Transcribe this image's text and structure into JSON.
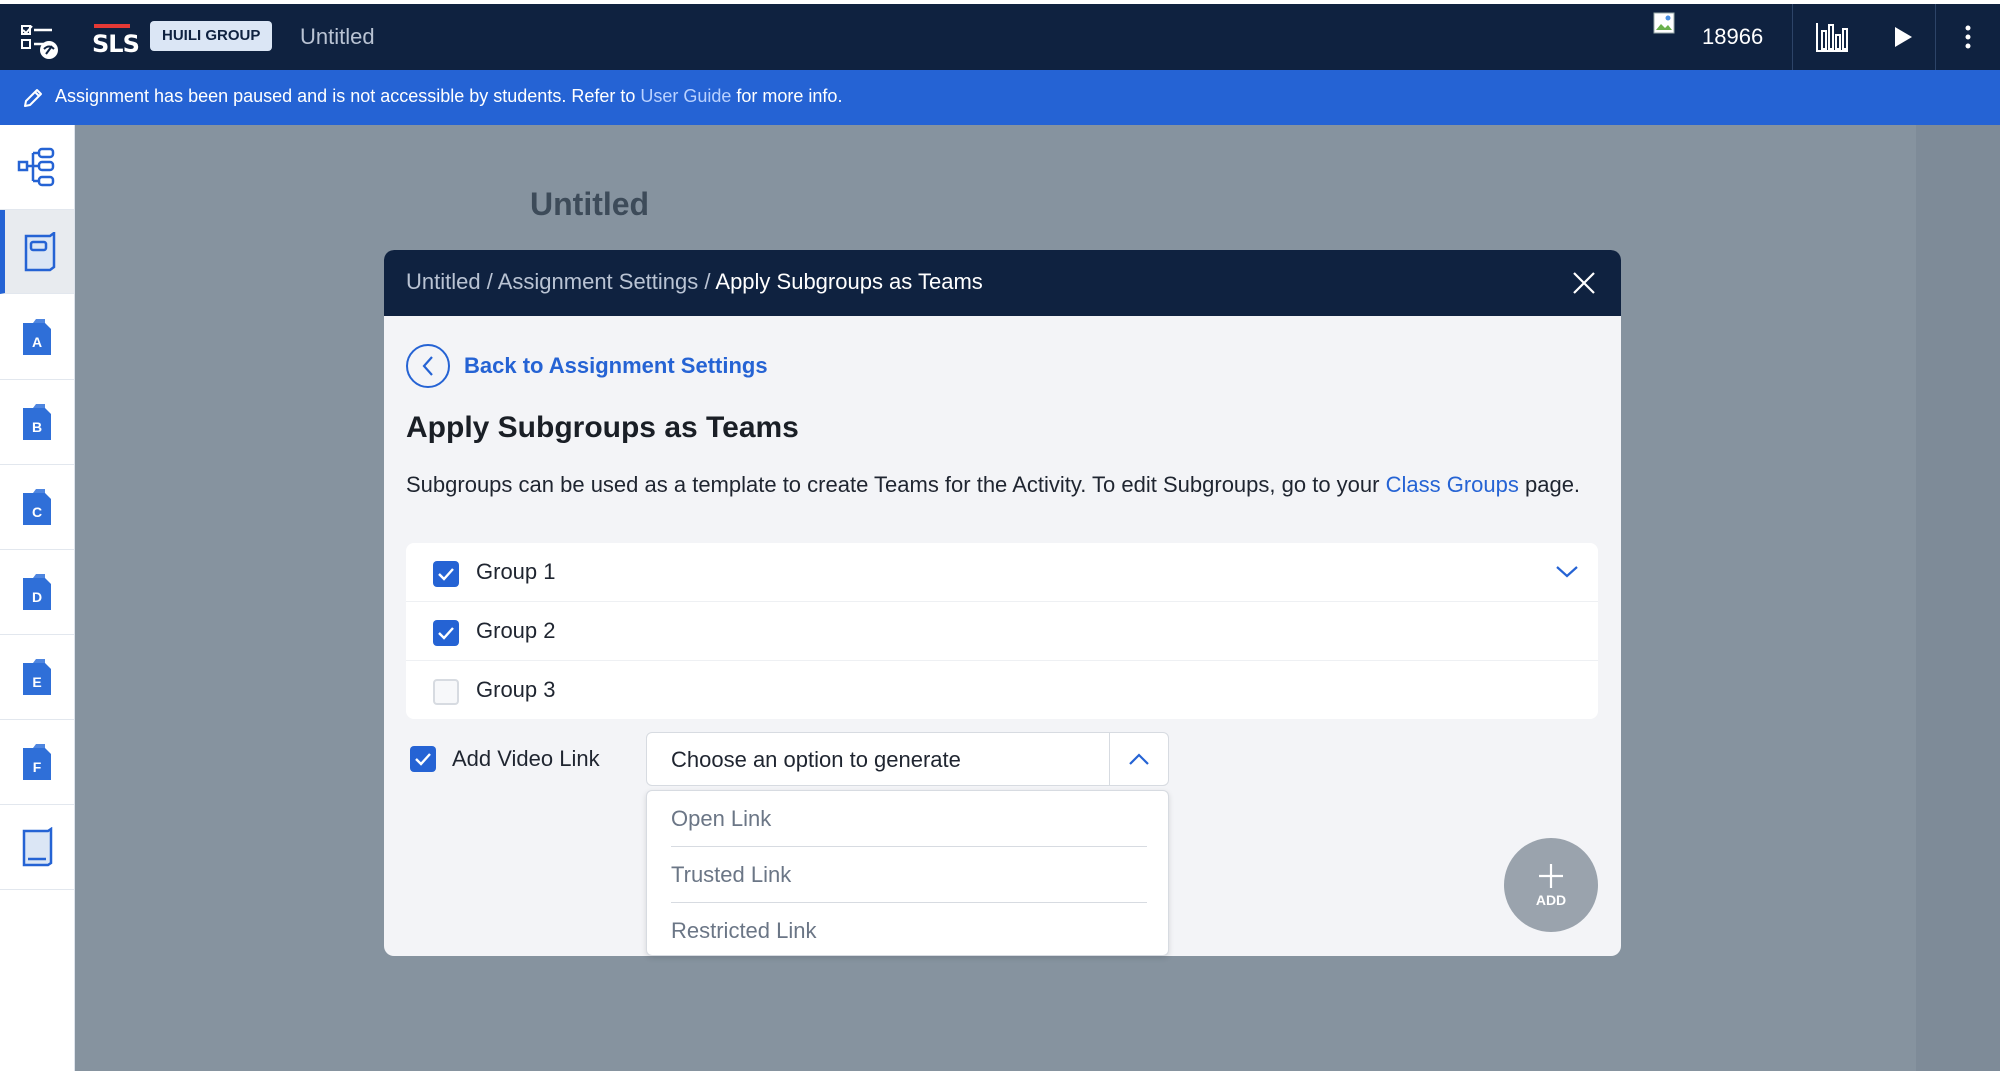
{
  "topbar": {
    "app_icon": "checklist-globe-icon",
    "logo_text": "SLS",
    "group_badge": "HUILI GROUP",
    "title": "Untitled",
    "points": "18966",
    "analytics_icon": "bar-chart-icon",
    "play_icon": "play-icon",
    "more_icon": "more-vertical-icon"
  },
  "banner": {
    "icon": "pencil-icon",
    "text_before": "Assignment has been paused and is not accessible by students. Refer to ",
    "link": "User Guide",
    "text_after": " for more info."
  },
  "sidebar": {
    "items": [
      {
        "icon": "tree-structure-icon"
      },
      {
        "icon": "cover-page-icon"
      },
      {
        "icon": "section-icon",
        "letter": "A"
      },
      {
        "icon": "section-icon",
        "letter": "B"
      },
      {
        "icon": "section-icon",
        "letter": "C"
      },
      {
        "icon": "section-icon",
        "letter": "D"
      },
      {
        "icon": "section-icon",
        "letter": "E"
      },
      {
        "icon": "section-icon",
        "letter": "F"
      },
      {
        "icon": "book-icon"
      }
    ]
  },
  "background": {
    "title": "Untitled"
  },
  "modal": {
    "breadcrumb": {
      "part1": "Untitled",
      "sep": " / ",
      "part2": "Assignment Settings",
      "current": "Apply Subgroups as Teams"
    },
    "back_label": "Back to Assignment Settings",
    "heading": "Apply Subgroups as Teams",
    "description_before": "Subgroups can be used as a template to create Teams for the Activity. To edit Subgroups, go to your ",
    "description_link": "Class Groups",
    "description_after": " page.",
    "groups": [
      {
        "label": "Group 1",
        "checked": true
      },
      {
        "label": "Group 2",
        "checked": true
      },
      {
        "label": "Group 3",
        "checked": false
      }
    ],
    "video_link": {
      "label": "Add Video Link",
      "checked": true,
      "select_value": "Choose an option to generate",
      "options": [
        "Open Link",
        "Trusted Link",
        "Restricted Link"
      ]
    },
    "add_button": "ADD"
  },
  "colors": {
    "navy": "#0f2240",
    "accent": "#2563d4",
    "overlay": "#86939f"
  }
}
